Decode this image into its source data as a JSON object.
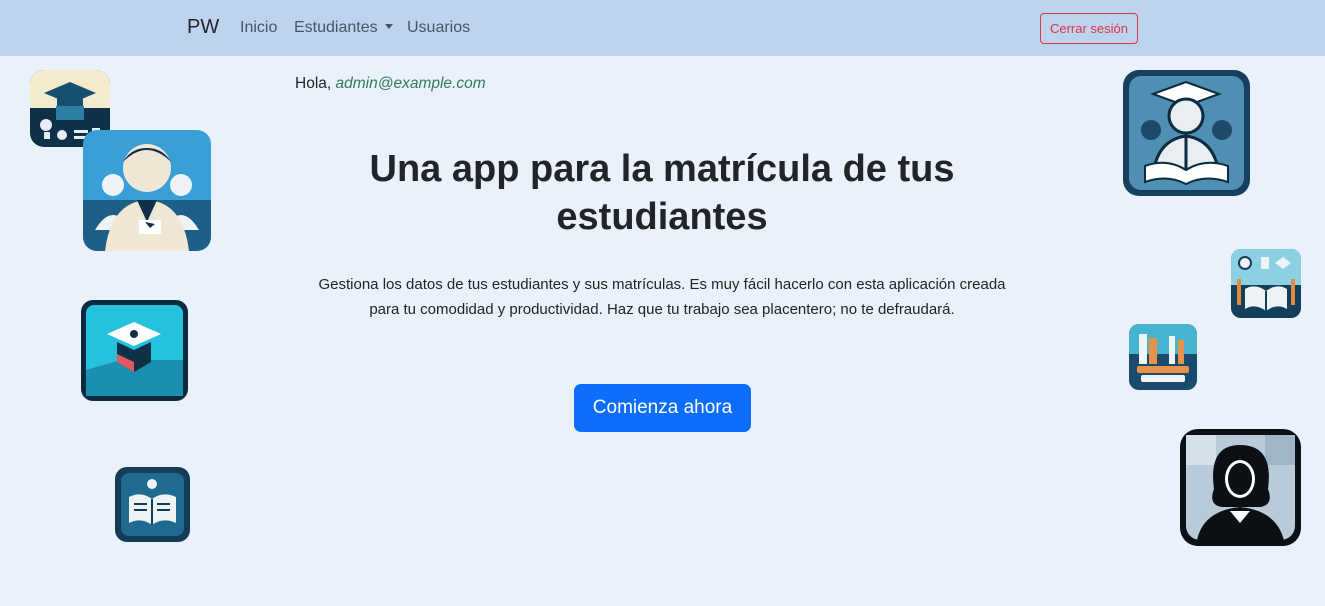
{
  "nav": {
    "brand": "PW",
    "links": [
      {
        "label": "Inicio"
      },
      {
        "label": "Estudiantes"
      },
      {
        "label": "Usuarios"
      }
    ],
    "logout_label": "Cerrar sesión"
  },
  "greeting": {
    "prefix": "Hola, ",
    "email": "admin@example.com"
  },
  "hero": {
    "title": "Una app para la matrícula de tus estudiantes",
    "description": "Gestiona los datos de tus estudiantes y sus matrículas. Es muy fácil hacerlo con esta aplicación creada para tu comodidad y productividad. Haz que tu trabajo sea placentero; no te defraudará.",
    "cta_label": "Comienza ahora"
  },
  "icons": {
    "left": [
      "graduation-dashboard-icon",
      "student-group-icon",
      "graduation-cap-icon",
      "open-book-icon"
    ],
    "right": [
      "graduate-reading-icon",
      "study-tools-icon",
      "books-pencils-icon",
      "female-avatar-icon"
    ]
  },
  "colors": {
    "navbar": "#bed3ee",
    "background": "#ebf1fa",
    "primary": "#0d6efd",
    "danger": "#dc3545",
    "email": "#2f7d57"
  }
}
